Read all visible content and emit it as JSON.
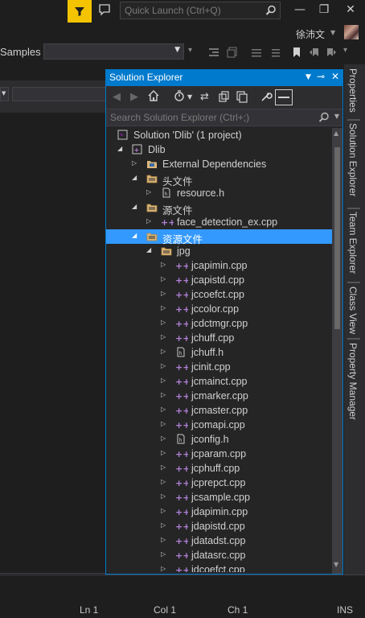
{
  "quick_launch": {
    "placeholder": "Quick Launch (Ctrl+Q)"
  },
  "window_controls": {
    "minimize": "—",
    "restore": "❐",
    "close": "✕"
  },
  "user": {
    "name": "徐沛文"
  },
  "toolbar": {
    "samples_label": "Samples",
    "samples_value": ""
  },
  "solution_explorer": {
    "title": "Solution Explorer",
    "search_placeholder": "Search Solution Explorer (Ctrl+;)",
    "tree": [
      {
        "label": "Solution 'Dlib' (1 project)",
        "level": 0,
        "icon": "solution-icon",
        "twisty": ""
      },
      {
        "label": "Dlib",
        "level": 1,
        "icon": "project-icon",
        "twisty": "expanded"
      },
      {
        "label": "External Dependencies",
        "level": 2,
        "icon": "external-dependencies-icon",
        "twisty": "collapsed"
      },
      {
        "label": "头文件",
        "level": 2,
        "icon": "folder-icon",
        "twisty": "expanded"
      },
      {
        "label": "resource.h",
        "level": 3,
        "icon": "header-file-icon",
        "twisty": "collapsed"
      },
      {
        "label": "源文件",
        "level": 2,
        "icon": "folder-icon",
        "twisty": "expanded"
      },
      {
        "label": "face_detection_ex.cpp",
        "level": 3,
        "icon": "cpp-file-icon",
        "twisty": "collapsed"
      },
      {
        "label": "资源文件",
        "level": 2,
        "icon": "folder-icon",
        "twisty": "expanded",
        "selected": true
      },
      {
        "label": "jpg",
        "level": 3,
        "icon": "folder-icon",
        "twisty": "expanded"
      },
      {
        "label": "jcapimin.cpp",
        "level": 4,
        "icon": "cpp-file-icon",
        "twisty": "collapsed"
      },
      {
        "label": "jcapistd.cpp",
        "level": 4,
        "icon": "cpp-file-icon",
        "twisty": "collapsed"
      },
      {
        "label": "jccoefct.cpp",
        "level": 4,
        "icon": "cpp-file-icon",
        "twisty": "collapsed"
      },
      {
        "label": "jccolor.cpp",
        "level": 4,
        "icon": "cpp-file-icon",
        "twisty": "collapsed"
      },
      {
        "label": "jcdctmgr.cpp",
        "level": 4,
        "icon": "cpp-file-icon",
        "twisty": "collapsed"
      },
      {
        "label": "jchuff.cpp",
        "level": 4,
        "icon": "cpp-file-icon",
        "twisty": "collapsed"
      },
      {
        "label": "jchuff.h",
        "level": 4,
        "icon": "header-file-icon",
        "twisty": "collapsed"
      },
      {
        "label": "jcinit.cpp",
        "level": 4,
        "icon": "cpp-file-icon",
        "twisty": "collapsed"
      },
      {
        "label": "jcmainct.cpp",
        "level": 4,
        "icon": "cpp-file-icon",
        "twisty": "collapsed"
      },
      {
        "label": "jcmarker.cpp",
        "level": 4,
        "icon": "cpp-file-icon",
        "twisty": "collapsed"
      },
      {
        "label": "jcmaster.cpp",
        "level": 4,
        "icon": "cpp-file-icon",
        "twisty": "collapsed"
      },
      {
        "label": "jcomapi.cpp",
        "level": 4,
        "icon": "cpp-file-icon",
        "twisty": "collapsed"
      },
      {
        "label": "jconfig.h",
        "level": 4,
        "icon": "header-file-icon",
        "twisty": "collapsed"
      },
      {
        "label": "jcparam.cpp",
        "level": 4,
        "icon": "cpp-file-icon",
        "twisty": "collapsed"
      },
      {
        "label": "jcphuff.cpp",
        "level": 4,
        "icon": "cpp-file-icon",
        "twisty": "collapsed"
      },
      {
        "label": "jcprepct.cpp",
        "level": 4,
        "icon": "cpp-file-icon",
        "twisty": "collapsed"
      },
      {
        "label": "jcsample.cpp",
        "level": 4,
        "icon": "cpp-file-icon",
        "twisty": "collapsed"
      },
      {
        "label": "jdapimin.cpp",
        "level": 4,
        "icon": "cpp-file-icon",
        "twisty": "collapsed"
      },
      {
        "label": "jdapistd.cpp",
        "level": 4,
        "icon": "cpp-file-icon",
        "twisty": "collapsed"
      },
      {
        "label": "jdatadst.cpp",
        "level": 4,
        "icon": "cpp-file-icon",
        "twisty": "collapsed"
      },
      {
        "label": "jdatasrc.cpp",
        "level": 4,
        "icon": "cpp-file-icon",
        "twisty": "collapsed"
      },
      {
        "label": "jdcoefct.cpp",
        "level": 4,
        "icon": "cpp-file-icon",
        "twisty": "collapsed"
      }
    ]
  },
  "side_tabs": [
    "Properties",
    "Solution Explorer",
    "Team Explorer",
    "Class View",
    "Property Manager"
  ],
  "status_bar": {
    "line": "Ln 1",
    "col": "Col 1",
    "ch": "Ch 1",
    "mode": "INS"
  },
  "colors": {
    "accent": "#007acc",
    "selection": "#3399ff",
    "filter_button": "#f5c400",
    "cpp_icon": "#b180d7"
  }
}
